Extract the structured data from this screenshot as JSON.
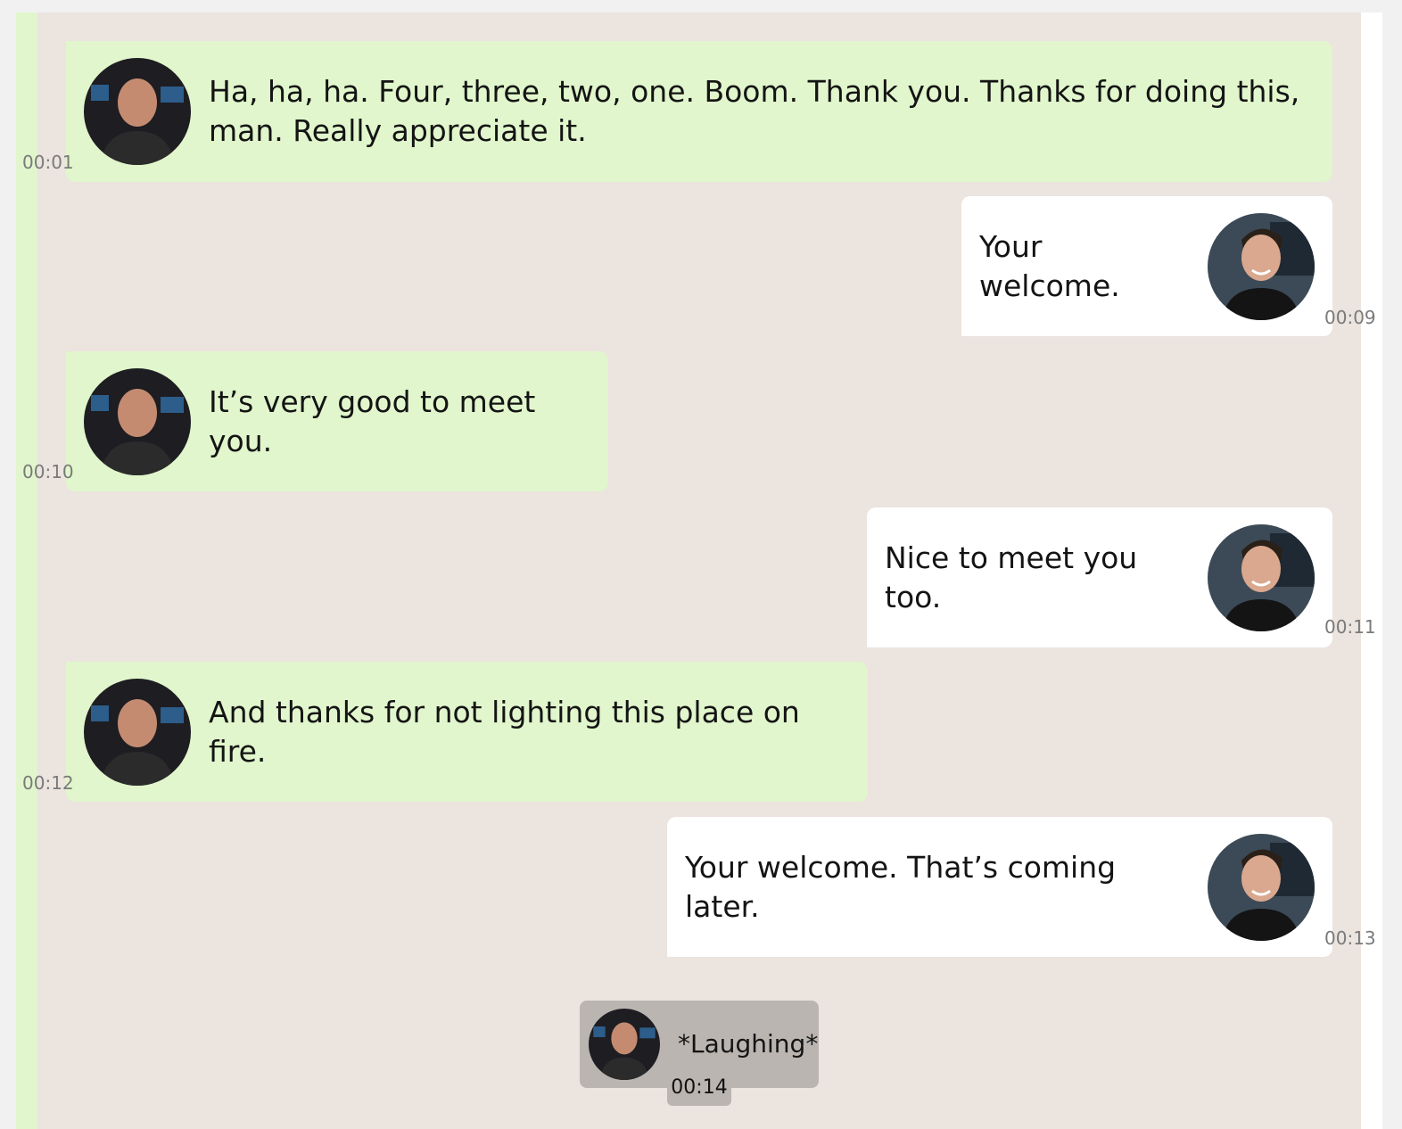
{
  "messages": [
    {
      "speaker": "host",
      "text": "Ha, ha, ha. Four, three, two, one. Boom. Thank you. Thanks for doing this, man. Really appreciate it.",
      "time": "00:01"
    },
    {
      "speaker": "guest",
      "text": "Your welcome.",
      "time": "00:09"
    },
    {
      "speaker": "host",
      "text": "It’s very good to meet you.",
      "time": "00:10"
    },
    {
      "speaker": "guest",
      "text": "Nice to meet you too.",
      "time": "00:11"
    },
    {
      "speaker": "host",
      "text": "And thanks for not lighting this place on fire.",
      "time": "00:12"
    },
    {
      "speaker": "guest",
      "text": "Your welcome. That’s coming later.",
      "time": "00:13"
    }
  ],
  "system_message": {
    "speaker": "host",
    "text": "*Laughing*",
    "time": "00:14"
  },
  "icons": {
    "host_avatar": "avatar-host-icon",
    "guest_avatar": "avatar-guest-icon"
  },
  "colors": {
    "host_bubble": "#e1f6cc",
    "guest_bubble": "#ffffff",
    "background": "#ebe4df",
    "system_bubble": "#bab5b1"
  }
}
